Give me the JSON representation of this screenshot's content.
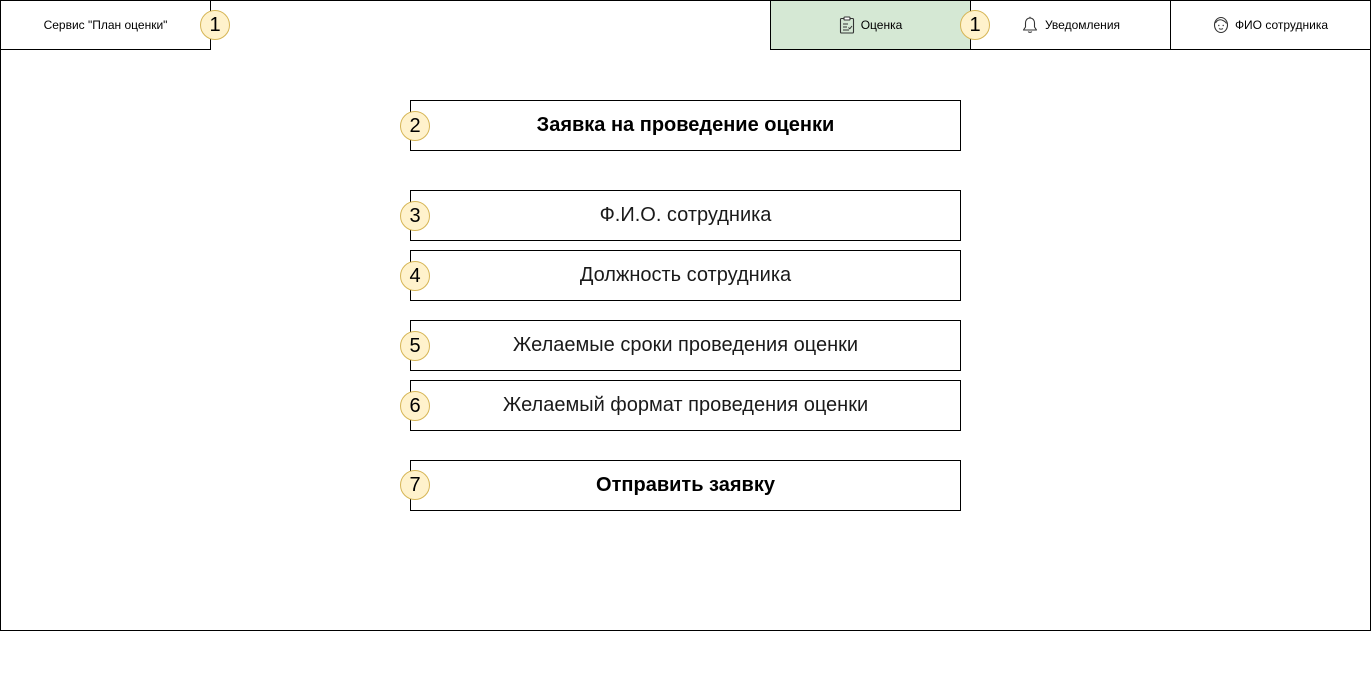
{
  "header": {
    "brand_label": "Сервис \"План оценки\"",
    "brand_marker": "1",
    "nav": {
      "assessment_label": "Оценка",
      "assessment_icon": "clipboard-check-icon",
      "assessment_marker": "1",
      "notifications_label": "Уведомления",
      "notifications_icon": "bell-icon",
      "profile_label": "ФИО сотрудника",
      "profile_icon": "user-face-icon"
    }
  },
  "form": {
    "title": "Заявка на проведение оценки",
    "title_marker": "2",
    "employee_name": "Ф.И.О. сотрудника",
    "employee_name_marker": "3",
    "employee_position": "Должность сотрудника",
    "employee_position_marker": "4",
    "desired_dates": "Желаемые сроки проведения оценки",
    "desired_dates_marker": "5",
    "desired_format": "Желаемый формат проведения оценки",
    "desired_format_marker": "6",
    "submit_label": "Отправить заявку",
    "submit_marker": "7"
  },
  "colors": {
    "active_tab": "#d5e8d4",
    "marker_fill": "#fff2cc",
    "marker_border": "#d6b656"
  }
}
